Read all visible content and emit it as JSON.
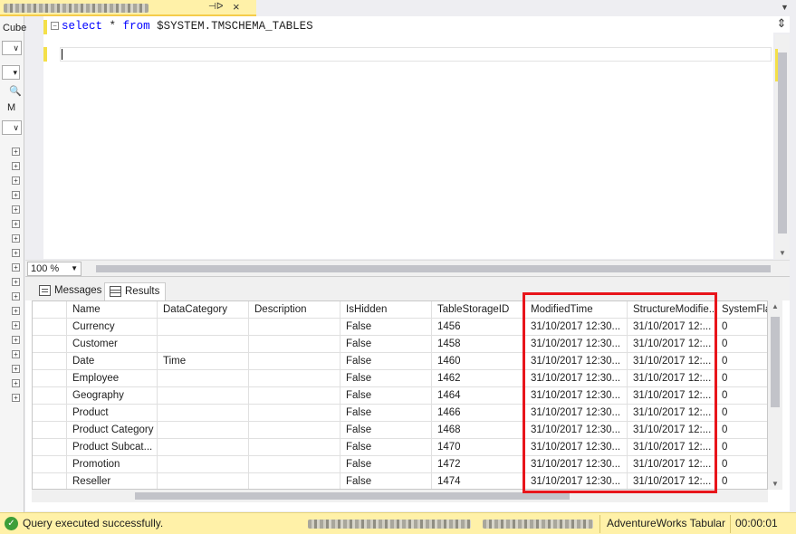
{
  "left_panel": {
    "label_cube": "Cube",
    "label_m": "M"
  },
  "editor": {
    "tokens": [
      {
        "text": "select",
        "kind": "keyword"
      },
      {
        "text": " ",
        "kind": "plain"
      },
      {
        "text": "*",
        "kind": "plain"
      },
      {
        "text": " ",
        "kind": "plain"
      },
      {
        "text": "from",
        "kind": "keyword"
      },
      {
        "text": " $SYSTEM.TMSCHEMA_TABLES",
        "kind": "plain"
      }
    ]
  },
  "zoom": {
    "value": "100 %"
  },
  "results_tabs": {
    "messages": "Messages",
    "results": "Results"
  },
  "grid": {
    "columns": [
      "Name",
      "DataCategory",
      "Description",
      "IsHidden",
      "TableStorageID",
      "ModifiedTime",
      "StructureModifie...",
      "SystemFlag"
    ],
    "rows": [
      [
        "Currency",
        "",
        "",
        "False",
        "1456",
        "31/10/2017 12:30...",
        "31/10/2017 12:...",
        "0"
      ],
      [
        "Customer",
        "",
        "",
        "False",
        "1458",
        "31/10/2017 12:30...",
        "31/10/2017 12:...",
        "0"
      ],
      [
        "Date",
        "Time",
        "",
        "False",
        "1460",
        "31/10/2017 12:30...",
        "31/10/2017 12:...",
        "0"
      ],
      [
        "Employee",
        "",
        "",
        "False",
        "1462",
        "31/10/2017 12:30...",
        "31/10/2017 12:...",
        "0"
      ],
      [
        "Geography",
        "",
        "",
        "False",
        "1464",
        "31/10/2017 12:30...",
        "31/10/2017 12:...",
        "0"
      ],
      [
        "Product",
        "",
        "",
        "False",
        "1466",
        "31/10/2017 12:30...",
        "31/10/2017 12:...",
        "0"
      ],
      [
        "Product Category",
        "",
        "",
        "False",
        "1468",
        "31/10/2017 12:30...",
        "31/10/2017 12:...",
        "0"
      ],
      [
        "Product Subcat...",
        "",
        "",
        "False",
        "1470",
        "31/10/2017 12:30...",
        "31/10/2017 12:...",
        "0"
      ],
      [
        "Promotion",
        "",
        "",
        "False",
        "1472",
        "31/10/2017 12:30...",
        "31/10/2017 12:...",
        "0"
      ],
      [
        "Reseller",
        "",
        "",
        "False",
        "1474",
        "31/10/2017 12:30...",
        "31/10/2017 12:...",
        "0"
      ]
    ]
  },
  "status": {
    "message": "Query executed successfully.",
    "database": "AdventureWorks Tabular",
    "elapsed": "00:00:01"
  },
  "colors": {
    "keyword": "#0000ff",
    "highlight": "#e8151b",
    "status_bg": "#fff1a8"
  }
}
